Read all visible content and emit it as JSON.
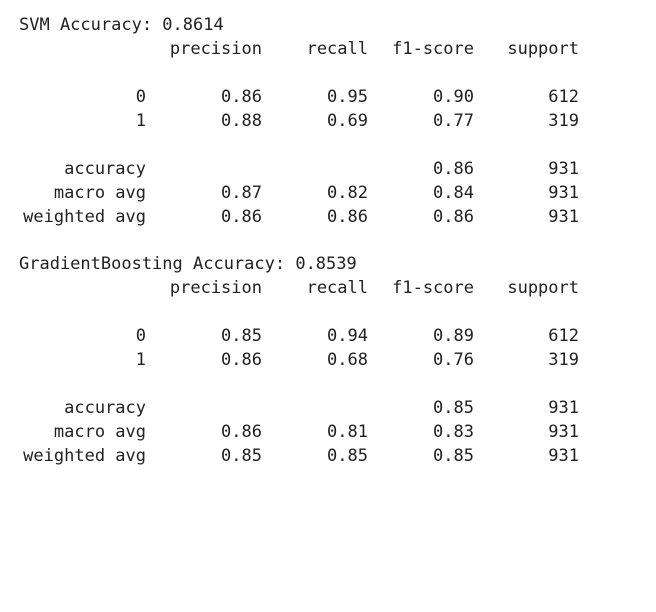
{
  "reports": [
    {
      "title": "SVM Accuracy: 0.8614",
      "headers": [
        "precision",
        "recall",
        "f1-score",
        "support"
      ],
      "rows": [
        {
          "label": "0",
          "precision": "0.86",
          "recall": "0.95",
          "f1": "0.90",
          "support": "612"
        },
        {
          "label": "1",
          "precision": "0.88",
          "recall": "0.69",
          "f1": "0.77",
          "support": "319"
        }
      ],
      "summary": [
        {
          "label": "accuracy",
          "precision": "",
          "recall": "",
          "f1": "0.86",
          "support": "931"
        },
        {
          "label": "macro avg",
          "precision": "0.87",
          "recall": "0.82",
          "f1": "0.84",
          "support": "931"
        },
        {
          "label": "weighted avg",
          "precision": "0.86",
          "recall": "0.86",
          "f1": "0.86",
          "support": "931"
        }
      ]
    },
    {
      "title": "GradientBoosting Accuracy: 0.8539",
      "headers": [
        "precision",
        "recall",
        "f1-score",
        "support"
      ],
      "rows": [
        {
          "label": "0",
          "precision": "0.85",
          "recall": "0.94",
          "f1": "0.89",
          "support": "612"
        },
        {
          "label": "1",
          "precision": "0.86",
          "recall": "0.68",
          "f1": "0.76",
          "support": "319"
        }
      ],
      "summary": [
        {
          "label": "accuracy",
          "precision": "",
          "recall": "",
          "f1": "0.85",
          "support": "931"
        },
        {
          "label": "macro avg",
          "precision": "0.86",
          "recall": "0.81",
          "f1": "0.83",
          "support": "931"
        },
        {
          "label": "weighted avg",
          "precision": "0.85",
          "recall": "0.85",
          "f1": "0.85",
          "support": "931"
        }
      ]
    }
  ]
}
